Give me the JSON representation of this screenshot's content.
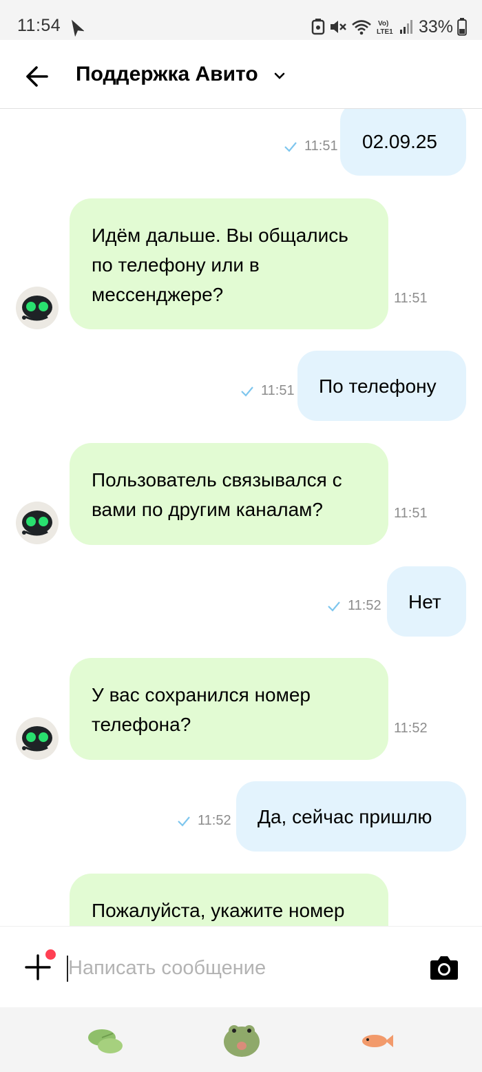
{
  "status_bar": {
    "time": "11:54",
    "battery": "33%"
  },
  "header": {
    "title": "Поддержка Авито"
  },
  "messages": [
    {
      "direction": "out",
      "text": "02.09.25",
      "time": "11:51"
    },
    {
      "direction": "in",
      "lines": [
        "Идём дальше. Вы общались",
        "по телефону или в",
        "мессенджере?"
      ],
      "time": "11:51"
    },
    {
      "direction": "out",
      "text": "По телефону",
      "time": "11:51"
    },
    {
      "direction": "in",
      "lines": [
        "Пользователь связывался с",
        "вами по другим каналам?"
      ],
      "time": "11:51"
    },
    {
      "direction": "out",
      "text": "Нет",
      "time": "11:52"
    },
    {
      "direction": "in",
      "lines": [
        "У вас сохранился номер",
        "телефона?"
      ],
      "time": "11:52"
    },
    {
      "direction": "out",
      "text": "Да, сейчас пришлю",
      "time": "11:52"
    },
    {
      "direction": "in",
      "lines": [
        "Пожалуйста, укажите номер"
      ],
      "time": ""
    }
  ],
  "composer": {
    "placeholder": "Написать сообщение",
    "value": ""
  },
  "stickers": [
    {
      "name": "lily-pad-sticker"
    },
    {
      "name": "frog-sticker"
    },
    {
      "name": "fish-sticker"
    }
  ],
  "colors": {
    "outgoing_bubble": "#e3f3fd",
    "incoming_bubble": "#e2fbd3",
    "read_check": "#7ec6ee",
    "notification_dot": "#ff4053"
  }
}
